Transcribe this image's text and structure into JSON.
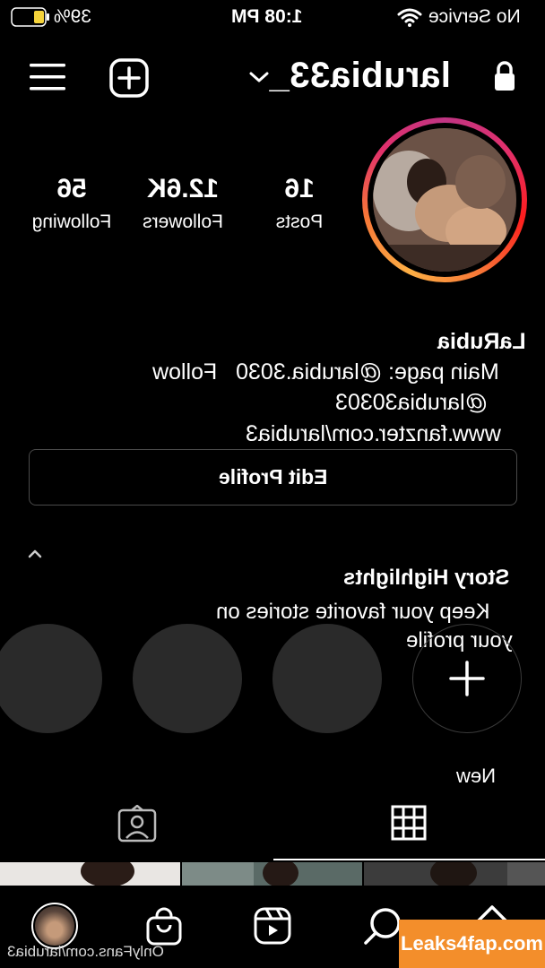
{
  "status_bar": {
    "battery": "39%",
    "time": "1:08 PM",
    "carrier": "No Service"
  },
  "header": {
    "username": "larubia33_"
  },
  "stats": [
    {
      "value": "16",
      "label": "Posts"
    },
    {
      "value": "12.6K",
      "label": "Followers"
    },
    {
      "value": "56",
      "label": "Following"
    }
  ],
  "bio": {
    "name": "LaRubia",
    "line1": "Main page: @larubia.3030   Follow",
    "line2": "@larubia30303",
    "line3": "www.fanzter.com/larubia3"
  },
  "edit_profile_label": "Edit Profile",
  "highlights": {
    "title": "Story Highlights",
    "subtitle_line1": "Keep your favorite stories on",
    "subtitle_line2": "your profile",
    "new_label": "New"
  },
  "watermarks": {
    "leaks": "Leaks4fap.com",
    "onlyfans": "OnlyFans.com/larubia3"
  },
  "icons": {
    "menu": "hamburger-menu-icon",
    "new_post": "plus-square-icon",
    "chevron": "chevron-down-icon",
    "lock": "lock-icon",
    "grid": "grid-icon",
    "tagged": "tagged-person-icon",
    "shop": "shopping-bag-icon",
    "reels": "reels-icon",
    "search": "search-icon",
    "home": "home-icon"
  },
  "colors": {
    "background": "#000000",
    "text": "#ffffff",
    "highlight_circle": "#2a2a2a",
    "watermark_orange": "#f38e2b",
    "battery_fill": "#f5d33a"
  }
}
